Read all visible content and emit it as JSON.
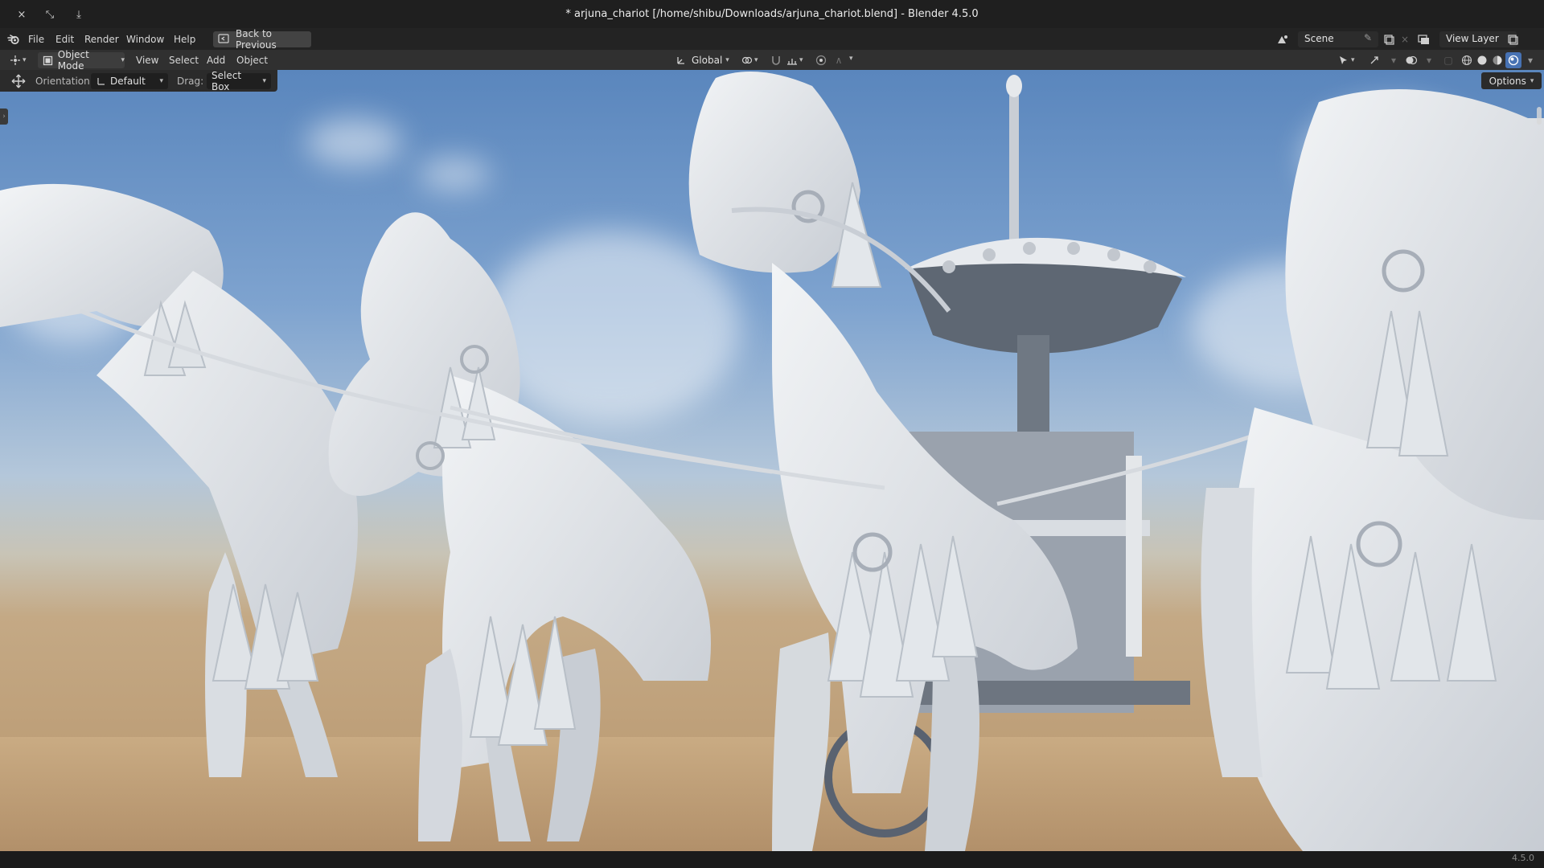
{
  "window": {
    "title": "* arjuna_chariot [/home/shibu/Downloads/arjuna_chariot.blend] - Blender 4.5.0",
    "close_icon": "×",
    "fullscreen_icon": "⤡",
    "minimize_icon": "⤓"
  },
  "topbar": {
    "menu": [
      "File",
      "Edit",
      "Render",
      "Window",
      "Help"
    ],
    "back_button": "Back to Previous",
    "scene": "Scene",
    "view_layer": "View Layer"
  },
  "viewport_header": {
    "mode": "Object Mode",
    "menus": [
      "View",
      "Select",
      "Add",
      "Object"
    ],
    "transform_orientation": "Global"
  },
  "tool_settings": {
    "orientation_label": "Orientation:",
    "orientation_value": "Default",
    "drag_label": "Drag:",
    "drag_value": "Select Box",
    "options": "Options"
  },
  "status": {
    "version": "4.5.0"
  },
  "colors": {
    "accent": "#4772b3",
    "header": "#303030",
    "sky_top": "#5a86bd",
    "sand": "#c4a780",
    "model_grey": "#e8eaec"
  }
}
